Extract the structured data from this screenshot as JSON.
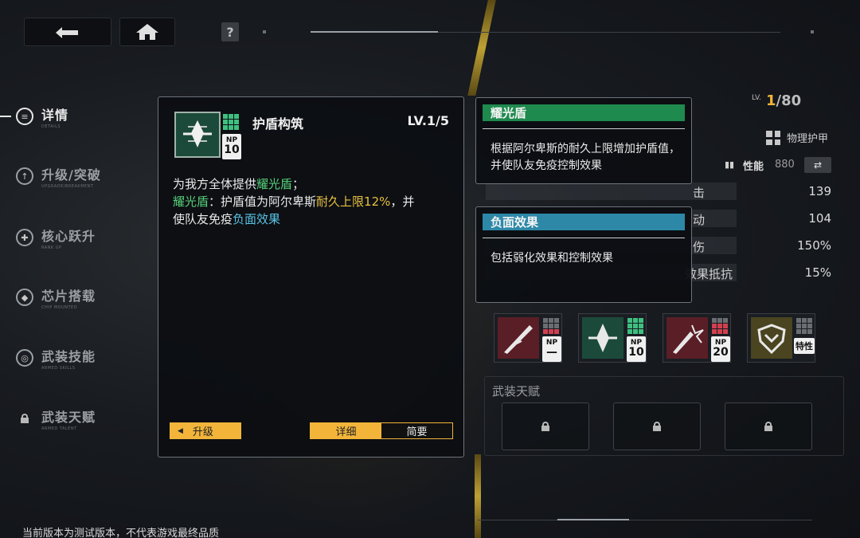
{
  "top": {
    "back_icon": "back-arrow-icon",
    "home_icon": "home-icon",
    "help_icon": "question-icon"
  },
  "nav": {
    "items": [
      {
        "label": "详情",
        "sub": "DETAILS",
        "icon": "details-icon"
      },
      {
        "label": "升级/突破",
        "sub": "UPGRADE/BREAKMENT",
        "icon": "upgrade-icon"
      },
      {
        "label": "核心跃升",
        "sub": "RANK UP",
        "icon": "core-icon"
      },
      {
        "label": "芯片搭载",
        "sub": "CHIP MOUNTED",
        "icon": "chip-icon"
      },
      {
        "label": "武装技能",
        "sub": "ARMED SKILLS",
        "icon": "skill-icon"
      },
      {
        "label": "武装天赋",
        "sub": "ARMED TALENT",
        "icon": "lock-icon"
      }
    ]
  },
  "skill_popup": {
    "title": "护盾构筑",
    "level": "LV.1/5",
    "np_label": "NP",
    "np_value": "10",
    "desc_line1_a": "为我方全体提供",
    "desc_line1_b": "耀光盾",
    "desc_line1_c": "；",
    "desc_line2_a": "耀光盾",
    "desc_line2_b": "：护盾值为阿尔卑斯",
    "desc_line2_c": "耐久上限12%",
    "desc_line2_d": "，并",
    "desc_line3_a": "使队友免疫",
    "desc_line3_b": "负面效果",
    "upgrade_label": "升级",
    "tab_detail": "详细",
    "tab_brief": "简要"
  },
  "tooltip1": {
    "title": "耀光盾",
    "body": "根据阿尔卑斯的耐久上限增加护盾值，并使队友免疫控制效果",
    "color": "#1f8a4e"
  },
  "tooltip2": {
    "title": "负面效果",
    "body": "包括弱化效果和控制效果",
    "color": "#2d88a8"
  },
  "right": {
    "lv_label": "LV.",
    "lv_current": "1",
    "lv_max": "/80",
    "armor_type": "物理护甲",
    "perf_label": "性能",
    "perf_value": "880",
    "stats": [
      {
        "label": "击",
        "value": "139"
      },
      {
        "label": "动",
        "value": "104"
      },
      {
        "label": "伤",
        "value": "150%"
      },
      {
        "label": "效果抵抗",
        "value": "15%"
      }
    ],
    "skills": [
      {
        "np": "NP",
        "cost": "—",
        "color": "#7a2630"
      },
      {
        "np": "NP",
        "cost": "10",
        "color": "#1c4a3a"
      },
      {
        "np": "NP",
        "cost": "20",
        "color": "#7a2630"
      },
      {
        "np": "特性",
        "cost": "",
        "color": "#4a4420"
      }
    ],
    "talent_title": "武装天赋"
  },
  "footer": {
    "note": "当前版本为测试版本，不代表游戏最终品质"
  }
}
